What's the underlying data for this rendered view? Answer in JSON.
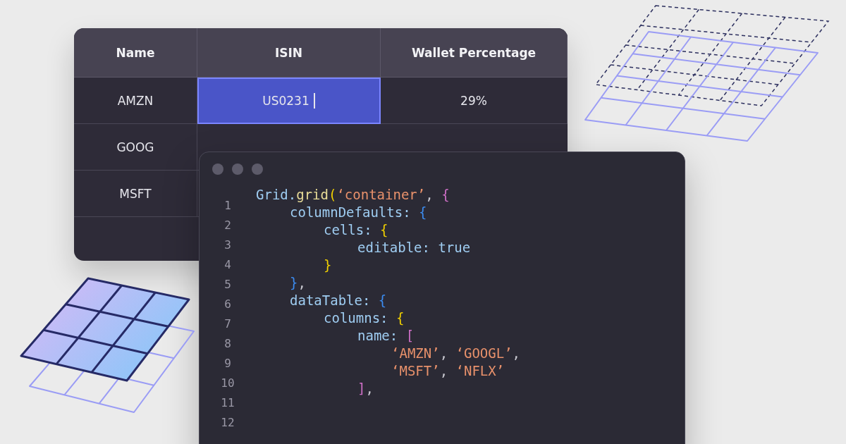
{
  "table": {
    "columns": [
      {
        "label": "Name"
      },
      {
        "label": "ISIN"
      },
      {
        "label": "Wallet Percentage"
      }
    ],
    "rows": [
      {
        "cells": [
          {
            "text": "AMZN",
            "selected": false
          },
          {
            "text": "US0231",
            "selected": true
          },
          {
            "text": "29%",
            "selected": false
          }
        ]
      },
      {
        "cells": [
          {
            "text": "GOOG",
            "selected": false
          }
        ]
      },
      {
        "cells": [
          {
            "text": "MSFT",
            "selected": false
          }
        ]
      }
    ]
  },
  "editor": {
    "line_numbers": [
      "1",
      "2",
      "3",
      "4",
      "5",
      "6",
      "7",
      "8",
      "9",
      "10",
      "11",
      "12"
    ],
    "code": [
      {
        "tokens": [
          {
            "text": "Grid.",
            "kind": "ident"
          },
          {
            "text": "grid",
            "kind": "method"
          },
          {
            "text": "(",
            "kind": "brace3"
          },
          {
            "text": "‘container’",
            "kind": "string"
          },
          {
            "text": ", ",
            "kind": "punct"
          },
          {
            "text": "{",
            "kind": "brace1"
          }
        ],
        "children": [
          {
            "tokens": [
              {
                "text": "columnDefaults: ",
                "kind": "ident"
              },
              {
                "text": "{",
                "kind": "brace2"
              }
            ],
            "children": [
              {
                "tokens": [
                  {
                    "text": "cells: ",
                    "kind": "ident"
                  },
                  {
                    "text": "{",
                    "kind": "brace3"
                  }
                ],
                "children": [
                  {
                    "tokens": [
                      {
                        "text": "editable: true",
                        "kind": "ident"
                      }
                    ]
                  }
                ]
              },
              {
                "tokens": [
                  {
                    "text": "}",
                    "kind": "brace3"
                  }
                ]
              }
            ]
          },
          {
            "tokens": [
              {
                "text": "}",
                "kind": "brace2"
              },
              {
                "text": ",",
                "kind": "punct"
              }
            ]
          },
          {
            "tokens": [
              {
                "text": "dataTable: ",
                "kind": "ident"
              },
              {
                "text": "{",
                "kind": "brace2"
              }
            ],
            "children": [
              {
                "tokens": [
                  {
                    "text": "columns: ",
                    "kind": "ident"
                  },
                  {
                    "text": "{",
                    "kind": "brace3"
                  }
                ],
                "children": [
                  {
                    "tokens": [
                      {
                        "text": "name: ",
                        "kind": "ident"
                      },
                      {
                        "text": "[",
                        "kind": "brace1"
                      }
                    ],
                    "children": [
                      {
                        "tokens": [
                          {
                            "text": "‘AMZN’",
                            "kind": "string"
                          },
                          {
                            "text": ", ",
                            "kind": "punct"
                          },
                          {
                            "text": "‘GOOGL’",
                            "kind": "string"
                          },
                          {
                            "text": ",",
                            "kind": "punct"
                          }
                        ]
                      },
                      {
                        "tokens": [
                          {
                            "text": "‘MSFT’",
                            "kind": "string"
                          },
                          {
                            "text": ", ",
                            "kind": "punct"
                          },
                          {
                            "text": "‘NFLX’",
                            "kind": "string"
                          }
                        ]
                      }
                    ]
                  },
                  {
                    "tokens": [
                      {
                        "text": "]",
                        "kind": "brace1"
                      },
                      {
                        "text": ",",
                        "kind": "punct"
                      }
                    ]
                  }
                ]
              }
            ]
          }
        ]
      }
    ]
  }
}
